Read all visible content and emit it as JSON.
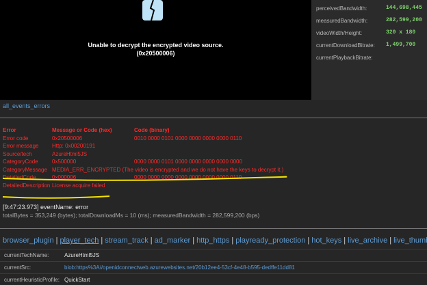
{
  "video": {
    "error_line1": "Unable to decrypt the encrypted video source.",
    "error_line2": "(0x20500006)",
    "icon": "broken-screen-icon"
  },
  "stats": [
    {
      "label": "perceivedBandwidth:",
      "value": "144,698,445"
    },
    {
      "label": "measuredBandwidth:",
      "value": "282,599,200"
    },
    {
      "label": "videoWidth/Height:",
      "value": "320 x 180"
    },
    {
      "label": "currentDownloadBitrate:",
      "value": "1,499,700"
    },
    {
      "label": "currentPlaybackBitrate:",
      "value": ""
    }
  ],
  "events_link": "all_events_errors",
  "error_table": {
    "headers": [
      "Error",
      "Message or Code (hex)",
      "Code (binary)"
    ],
    "rows": [
      [
        "Error code",
        "0x20500006",
        "0010 0000 0101 0000 0000 0000 0000 0110"
      ],
      [
        "Error message",
        "Http: 0x00200191",
        ""
      ],
      [
        "Source/tech",
        "AzureHtml5JS",
        ""
      ],
      [
        "CategoryCode",
        "0x500000",
        "0000 0000 0101 0000 0000 0000 0000 0000"
      ],
      [
        "CategoryMessage",
        "MEDIA_ERR_ENCRYPTED (The video is encrypted and we do not have the keys to decrypt it.)",
        ""
      ],
      [
        "DetailedCode",
        "0x000006",
        "0000 0000 0000 0000 0000 0000 0000 0110"
      ],
      [
        "DetailedDescription",
        "License acquire failed",
        ""
      ]
    ]
  },
  "event_line": "[9:47:23.973] eventName: error",
  "totals_line": "totalBytes = 353,249 (bytes); totalDownloadMs = 10 (ms); measuredBandwidth = 282,599,200 (bps)",
  "nav": [
    {
      "label": "browser_plugin",
      "active": false
    },
    {
      "label": "player_tech",
      "active": true
    },
    {
      "label": "stream_track",
      "active": false
    },
    {
      "label": "ad_marker",
      "active": false
    },
    {
      "label": "http_https",
      "active": false
    },
    {
      "label": "playready_protection",
      "active": false
    },
    {
      "label": "hot_keys",
      "active": false
    },
    {
      "label": "live_archive",
      "active": false
    },
    {
      "label": "live_thumbnails",
      "active": false
    }
  ],
  "info": [
    {
      "label": "currentTechName:",
      "value": "AzureHtml5JS",
      "link": false
    },
    {
      "label": "currentSrc:",
      "value": "blob:https%3A//openidconnectweb.azurewebsites.net/20b12ee4-53cf-4e48-b595-dedffe11dd81",
      "link": true
    },
    {
      "label": "currentHeuristicProfile:",
      "value": "QuickStart",
      "link": false
    }
  ],
  "colors": {
    "error_red": "#ff2b2b",
    "stat_green": "#7fd36e",
    "link_blue": "#5b9bd5",
    "highlight_yellow": "#f5e400"
  }
}
